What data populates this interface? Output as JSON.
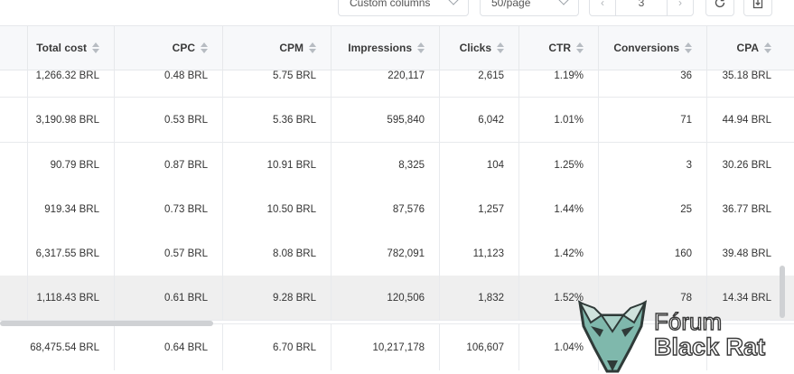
{
  "toolbar": {
    "columns_select": "Custom columns",
    "page_size_select": "50/page",
    "current_page": "3",
    "prev_icon": "chevron-left-icon",
    "next_icon": "chevron-right-icon",
    "refresh_icon": "refresh-icon",
    "export_icon": "export-icon"
  },
  "columns": [
    "Total cost",
    "CPC",
    "CPM",
    "Impressions",
    "Clicks",
    "CTR",
    "Conversions",
    "CPA"
  ],
  "rows": [
    {
      "total_cost": "1,266.32 BRL",
      "cpc": "0.48 BRL",
      "cpm": "5.75 BRL",
      "impressions": "220,117",
      "clicks": "2,615",
      "ctr": "1.19%",
      "conversions": "36",
      "cpa": "35.18 BRL"
    },
    {
      "total_cost": "3,190.98 BRL",
      "cpc": "0.53 BRL",
      "cpm": "5.36 BRL",
      "impressions": "595,840",
      "clicks": "6,042",
      "ctr": "1.01%",
      "conversions": "71",
      "cpa": "44.94 BRL"
    },
    {
      "total_cost": "90.79 BRL",
      "cpc": "0.87 BRL",
      "cpm": "10.91 BRL",
      "impressions": "8,325",
      "clicks": "104",
      "ctr": "1.25%",
      "conversions": "3",
      "cpa": "30.26 BRL"
    },
    {
      "total_cost": "919.34 BRL",
      "cpc": "0.73 BRL",
      "cpm": "10.50 BRL",
      "impressions": "87,576",
      "clicks": "1,257",
      "ctr": "1.44%",
      "conversions": "25",
      "cpa": "36.77 BRL"
    },
    {
      "total_cost": "6,317.55 BRL",
      "cpc": "0.57 BRL",
      "cpm": "8.08 BRL",
      "impressions": "782,091",
      "clicks": "11,123",
      "ctr": "1.42%",
      "conversions": "160",
      "cpa": "39.48 BRL"
    },
    {
      "total_cost": "1,118.43 BRL",
      "cpc": "0.61 BRL",
      "cpm": "9.28 BRL",
      "impressions": "120,506",
      "clicks": "1,832",
      "ctr": "1.52%",
      "conversions": "78",
      "cpa": "14.34 BRL"
    }
  ],
  "totals": {
    "total_cost": "68,475.54 BRL",
    "cpc": "0.64 BRL",
    "cpm": "6.70 BRL",
    "impressions": "10,217,178",
    "clicks": "106,607",
    "ctr": "1.04%",
    "conversions": "",
    "cpa": ""
  },
  "watermark": {
    "line1": "Fórum",
    "line2": "Black Rat"
  }
}
